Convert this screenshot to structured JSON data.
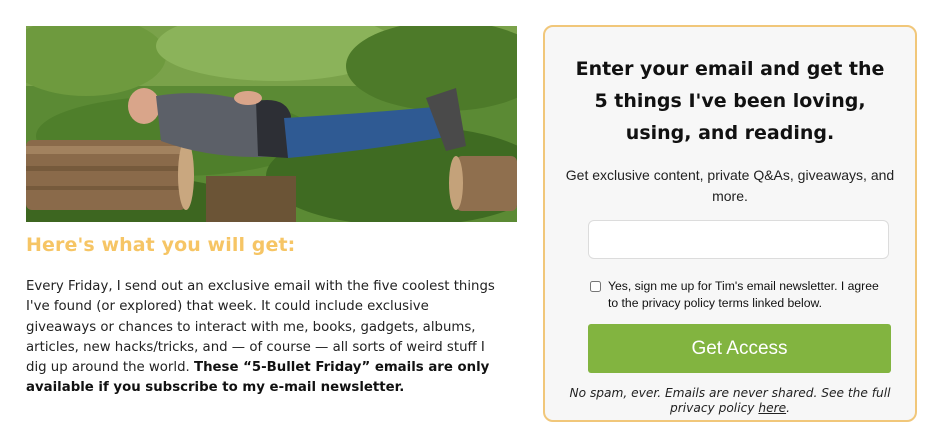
{
  "hero": {
    "image_alt": "Man lying across two logs in the grass"
  },
  "benefits": {
    "heading": "Here's what you will get:",
    "body_intro": "Every Friday, I send out an exclusive email with the five coolest things I've found (or explored) that week. It could include exclusive giveaways or chances to interact with me, books, gadgets, albums, articles, new hacks/tricks, and — of course — all sorts of weird stuff I dig up around the world.",
    "body_bold": "These “5-Bullet Friday” emails are only available if you subscribe to my e-mail newsletter."
  },
  "signup": {
    "title_line1": "Enter your email and get the",
    "title_line2": "5 things I've been loving,",
    "title_line3": "using, and reading.",
    "subtitle": "Get exclusive content, private Q&As, giveaways, and more.",
    "email_value": "",
    "email_placeholder": "",
    "consent_label": "Yes, sign me up for Tim's email newsletter. I agree to the privacy policy terms linked below.",
    "consent_checked": false,
    "submit_label": "Get Access",
    "disclaimer_text": "No spam, ever. Emails are never shared. See the full privacy policy ",
    "disclaimer_link": "here",
    "disclaimer_end": "."
  },
  "colors": {
    "heading_accent": "#f6c565",
    "card_border": "#f1c77a",
    "button_green": "#82b440"
  }
}
